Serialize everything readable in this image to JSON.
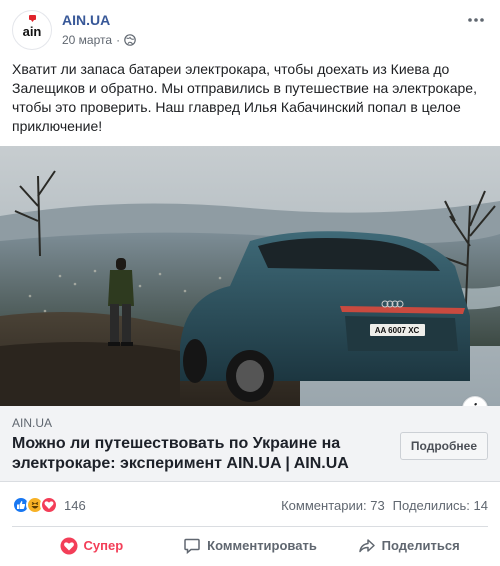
{
  "post": {
    "page_name": "AIN.UA",
    "avatar_text": "ain",
    "date": "20 марта",
    "separator": "·",
    "text": "Хватит ли запаса батареи электрокара, чтобы доехать из Киева до Залещиков и обратно. Мы отправились в путешествие на электрокаре, чтобы это проверить. Наш главред Илья Кабачинский попал в целое приключение!",
    "license_plate": "AA 6007 XC"
  },
  "link": {
    "domain": "AIN.UA",
    "title": "Можно ли путешествовать по Украине на электрокаре: эксперимент AIN.UA | AIN.UA",
    "button_label": "Подробнее",
    "info_label": "i"
  },
  "stats": {
    "reaction_count": "146",
    "comments": "Комментарии: 73",
    "shares": "Поделились: 14"
  },
  "actions": {
    "like": "Супер",
    "comment": "Комментировать",
    "share": "Поделиться"
  },
  "colors": {
    "link_blue": "#385898",
    "love_red": "#f33e58",
    "like_blue": "#1877f2",
    "haha_yellow": "#f7b125",
    "avatar_red": "#e0242c"
  },
  "icons": [
    "globe-icon",
    "more-dots-icon",
    "info-icon",
    "like-reaction-icon",
    "haha-reaction-icon",
    "love-reaction-icon",
    "heart-icon",
    "comment-icon",
    "share-icon"
  ]
}
